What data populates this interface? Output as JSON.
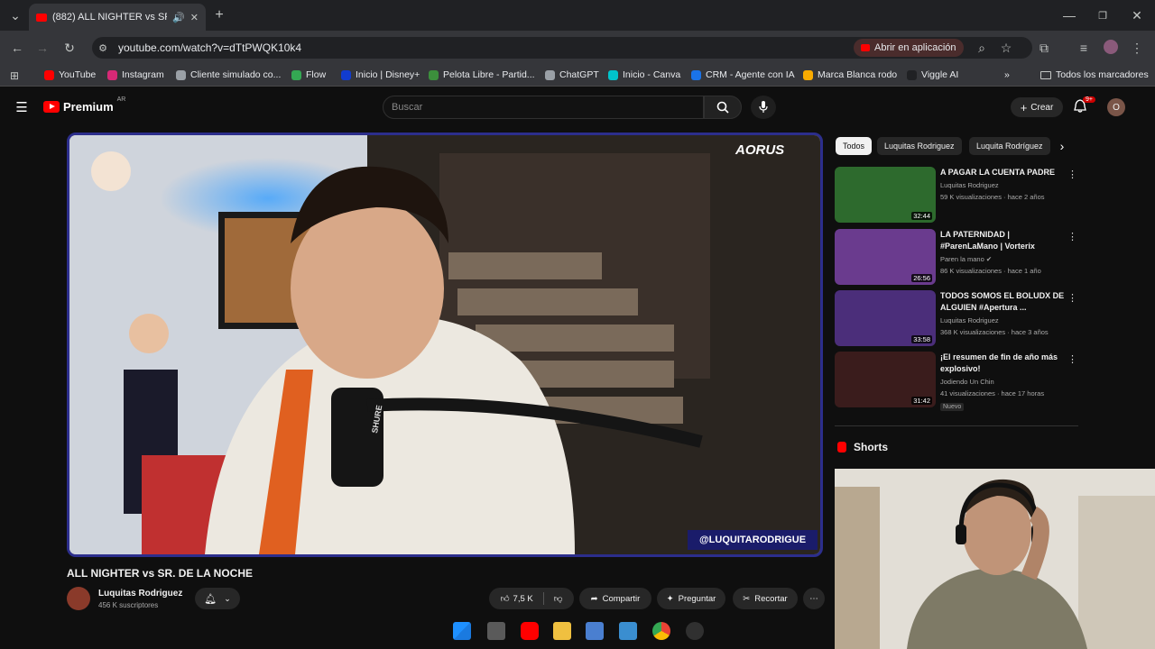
{
  "browser": {
    "tab_title": "(882) ALL NIGHTER vs SR. D",
    "new_tab": "+",
    "url": "youtube.com/watch?v=dTtPWQK10k4",
    "open_app": "Abrir en aplicación",
    "bookmarks": [
      {
        "label": "YouTube",
        "color": "#ff0000"
      },
      {
        "label": "Instagram",
        "color": "#d62976"
      },
      {
        "label": "Cliente simulado co...",
        "color": "#9aa0a6"
      },
      {
        "label": "Flow",
        "color": "#34a853"
      },
      {
        "label": "Inicio | Disney+",
        "color": "#113ccf"
      },
      {
        "label": "Pelota Libre - Partid...",
        "color": "#3c8f3c"
      },
      {
        "label": "ChatGPT",
        "color": "#9aa0a6"
      },
      {
        "label": "Inicio - Canva",
        "color": "#00c4cc"
      },
      {
        "label": "CRM - Agente con IA",
        "color": "#1a73e8"
      },
      {
        "label": "Marca Blanca rodo",
        "color": "#f9ab00"
      },
      {
        "label": "Viggle AI",
        "color": "#202124"
      }
    ],
    "more_bookmarks": "»",
    "all_bookmarks": "Todos los marcadores"
  },
  "youtube": {
    "brand": "Premium",
    "region": "AR",
    "search_placeholder": "Buscar",
    "create_label": "Crear",
    "notif_count": "9+",
    "avatar_initial": "O"
  },
  "video": {
    "watermark": "@LUQUITARODRIGUE",
    "overlay_brand": "AORUS",
    "mic_brand": "SHURE",
    "title": "ALL NIGHTER vs SR. DE LA NOCHE",
    "channel": "Luquitas Rodriguez",
    "subscribers": "456 K suscriptores",
    "likes": "7,5 K",
    "share": "Compartir",
    "ask": "Preguntar",
    "clip": "Recortar"
  },
  "sidebar": {
    "chips": [
      "Todos",
      "Luquitas Rodriguez",
      "Luquita Rodríguez"
    ],
    "recommendations": [
      {
        "title": "A PAGAR LA CUENTA PADRE",
        "channel": "Luquitas Rodriguez",
        "meta": "59 K visualizaciones · hace 2 años",
        "duration": "32:44",
        "thumb_color": "#2d6a2d"
      },
      {
        "title": "LA PATERNIDAD | #ParenLaMano | Vorterix",
        "channel": "Paren la mano",
        "meta": "86 K visualizaciones · hace 1 año",
        "duration": "26:56",
        "thumb_color": "#6a3b8e"
      },
      {
        "title": "TODOS SOMOS EL BOLUDX DE ALGUIEN #Apertura ...",
        "channel": "Luquitas Rodriguez",
        "meta": "368 K visualizaciones · hace 3 años",
        "duration": "33:58",
        "thumb_color": "#4b2e7a"
      },
      {
        "title": "¡El resumen de fin de año más explosivo!",
        "channel": "Jodiendo Un Chin",
        "meta": "41 visualizaciones · hace 17 horas",
        "duration": "31:42",
        "thumb_color": "#3a1c1c"
      }
    ],
    "new_badge": "Nuevo",
    "shorts_label": "Shorts"
  }
}
